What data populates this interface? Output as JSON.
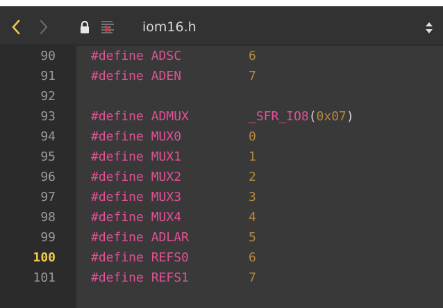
{
  "toolbar": {
    "back_icon": "chevron-left-icon",
    "forward_icon": "chevron-right-icon",
    "lock_icon": "lock-icon",
    "file_icon": "header-file-icon",
    "filename": "iom16.h",
    "updown_icon": "up-down-arrows-icon"
  },
  "colors": {
    "gutter_bg": "#2b2b2b",
    "editor_bg": "#393939",
    "keyword": "#e25196",
    "number": "#b5893e",
    "line_number": "#9a9a9a",
    "current_line_number": "#f2c94c",
    "back_arrow": "#f2c94c"
  },
  "current_line": "100",
  "lines": [
    {
      "num": "90",
      "name": "#define ADSC",
      "value": "6"
    },
    {
      "num": "91",
      "name": "#define ADEN",
      "value": "7"
    },
    {
      "num": "92",
      "name": "",
      "value": ""
    },
    {
      "num": "93",
      "name": "#define ADMUX",
      "func": "_SFR_IO8",
      "open": "(",
      "hex": "0x07",
      "close": ")"
    },
    {
      "num": "94",
      "name": "#define MUX0",
      "value": "0"
    },
    {
      "num": "95",
      "name": "#define MUX1",
      "value": "1"
    },
    {
      "num": "96",
      "name": "#define MUX2",
      "value": "2"
    },
    {
      "num": "97",
      "name": "#define MUX3",
      "value": "3"
    },
    {
      "num": "98",
      "name": "#define MUX4",
      "value": "4"
    },
    {
      "num": "99",
      "name": "#define ADLAR",
      "value": "5"
    },
    {
      "num": "100",
      "name": "#define REFS0",
      "value": "6"
    },
    {
      "num": "101",
      "name": "#define REFS1",
      "value": "7"
    }
  ]
}
